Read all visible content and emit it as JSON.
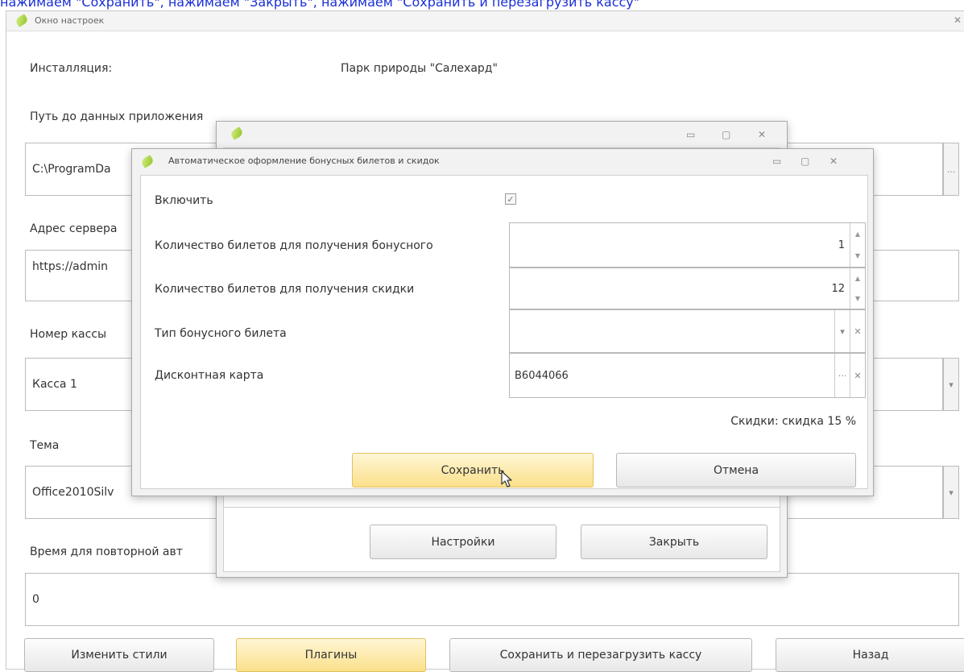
{
  "top_text": "нажимаем \"Сохранить\", нажимаем \"Закрыть\", нажимаем \"Сохранить и перезагрузить кассу\"",
  "main_window": {
    "title": "Окно настроек",
    "install_label": "Инсталляция:",
    "install_value": "Парк природы \"Салехард\"",
    "path_label": "Путь до данных приложения",
    "path_value": "C:\\ProgramDa",
    "path_browse": "...",
    "server_label": "Адрес сервера",
    "server_value": "https://admin",
    "cash_label": "Номер кассы",
    "cash_value": "Касса 1",
    "theme_label": "Тема",
    "theme_value": "Office2010Silv",
    "time_label": "Время для повторной авт",
    "time_value": "0",
    "buttons": {
      "change_styles": "Изменить стили",
      "plugins": "Плагины",
      "save_restart": "Сохранить и перезагрузить кассу",
      "back": "Назад"
    }
  },
  "plugins_window": {
    "settings_button": "Настройки",
    "close_button": "Закрыть"
  },
  "bonus_dialog": {
    "title": "Автоматическое оформление бонусных билетов и скидок",
    "enable_label": "Включить",
    "enable_checked": true,
    "bonus_qty_label": "Количество билетов для получения бонусного",
    "bonus_qty_value": "1",
    "discount_qty_label": "Количество билетов для получения скидки",
    "discount_qty_value": "12",
    "bonus_type_label": "Тип бонусного билета",
    "bonus_type_value": "",
    "card_label": "Дисконтная карта",
    "card_value": "B6044066",
    "discount_info": "Скидки: скидка 15 %",
    "save_button": "Сохранить",
    "cancel_button": "Отмена"
  },
  "icons": {
    "app": "leaf-icon",
    "minimize": "minimize-icon",
    "maximize": "maximize-icon",
    "close": "close-icon",
    "clear": "clear-icon",
    "dropdown": "chevron-down-icon",
    "spin_up": "spin-up-icon",
    "spin_down": "spin-down-icon",
    "check": "check-icon",
    "cursor": "mouse-cursor-icon"
  },
  "colors": {
    "link_text": "#1a2fd6",
    "active_button": "#fbe08a",
    "leaf": "#8ec21e"
  }
}
